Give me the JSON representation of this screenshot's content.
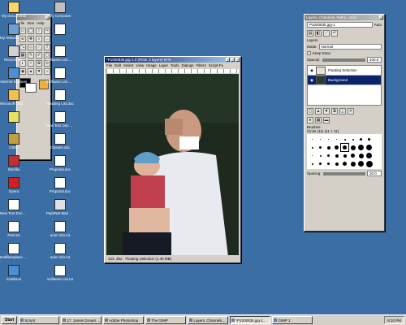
{
  "desktop": {
    "icons_left": [
      {
        "label": "My Documents",
        "color": "#f6d66b"
      },
      {
        "label": "My Network Places",
        "color": "#6aa0d8"
      },
      {
        "label": "Recycle Bin",
        "color": "#d0d0d0"
      },
      {
        "label": "Internet Explorer",
        "color": "#4a8fd8"
      },
      {
        "label": "Microsoft Outlook",
        "color": "#f0c050"
      },
      {
        "label": "",
        "color": "#e8e060"
      },
      {
        "label": "GIMP",
        "color": "#c0a040"
      },
      {
        "label": "Mozilla",
        "color": "#c03030"
      },
      {
        "label": "Opera",
        "color": "#d02020"
      },
      {
        "label": "New Text Document.txt",
        "color": "#ffffff"
      },
      {
        "label": "Pent.txt",
        "color": "#ffffff"
      },
      {
        "label": "textfilereplace Enemy-Tex...",
        "color": "#ffffff"
      },
      {
        "label": "Sciabsoe",
        "color": "#4a8fd8"
      }
    ],
    "icons_right": [
      {
        "label": "My Computer",
        "color": "#c0c0c0"
      },
      {
        "label": "",
        "color": "#ffffff"
      },
      {
        "label": "Software List.doc",
        "color": "#ffffff"
      },
      {
        "label": "Software List.doc",
        "color": "#ffffff"
      },
      {
        "label": "Reading List.doc",
        "color": "#ffffff"
      },
      {
        "label": "New Text Docum...",
        "color": "#ffffff"
      },
      {
        "label": "Classes.doc",
        "color": "#ffffff"
      },
      {
        "label": "Proposal.doc",
        "color": "#ffffff"
      },
      {
        "label": "Proposal.doc",
        "color": "#ffffff"
      },
      {
        "label": "PaintNet BlazeFtp",
        "color": "#e0e0e0"
      },
      {
        "label": "anim info.txt",
        "color": "#ffffff"
      },
      {
        "label": "anim info.txt",
        "color": "#ffffff"
      },
      {
        "label": "Software List.txt",
        "color": "#ffffff"
      }
    ]
  },
  "toolbox": {
    "menu": [
      "File",
      "Xtns",
      "Help"
    ],
    "tools": [
      "▭",
      "◯",
      "⌇",
      "✂",
      "⊕",
      "✥",
      "⌕",
      "↔",
      "⤡",
      "◇",
      "⟋",
      "T",
      "▦",
      "✎",
      "✐",
      "▢",
      "◐",
      "≈",
      "✿",
      "⊙",
      "◉",
      "▲",
      "▼",
      "☼"
    ]
  },
  "image_window": {
    "title": "*P1000835.jpg-1.0 (RGB, 2 layers) 67%",
    "menu": [
      "File",
      "Edit",
      "Select",
      "View",
      "Image",
      "Layer",
      "Tools",
      "Dialogs",
      "Filters",
      "Script-Fu"
    ],
    "status": "Floating Selection (1.46 MB)",
    "coords": "123, 352"
  },
  "layers_dialog": {
    "title": "Layers, Channels, Paths, Undo",
    "image_select": "P1000835.jpg-1",
    "auto_label": "Auto",
    "section_label": "Layers",
    "mode_label": "Mode:",
    "mode_value": "Normal",
    "keep_trans_label": "Keep trans.",
    "opacity_label": "Opacity:",
    "opacity_value": "100.0",
    "layers": [
      {
        "name": "Floating Selection",
        "selected": false
      },
      {
        "name": "Background",
        "selected": true
      }
    ],
    "brushes_label": "Brushes",
    "brush_name": "Circle (11) (11 × 11)",
    "spacing_label": "Spacing:",
    "spacing_value": "20.0"
  },
  "taskbar": {
    "start_label": "Start",
    "buttons": [
      {
        "label": "Scrynt",
        "active": false
      },
      {
        "label": "17. James Drouet -...",
        "active": false
      },
      {
        "label": "Adobe Photoshop",
        "active": false
      },
      {
        "label": "The GIMP",
        "active": false
      },
      {
        "label": "Layers, Channels, Pa...",
        "active": false
      },
      {
        "label": "*P1000835.jpg-1...",
        "active": true
      },
      {
        "label": "GIMP 2",
        "active": false
      }
    ],
    "clock": "8:10 PM"
  }
}
